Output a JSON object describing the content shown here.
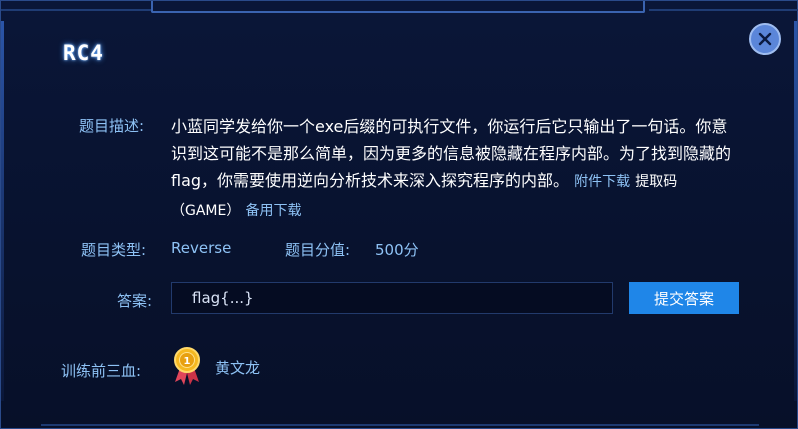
{
  "challenge": {
    "title": "RC4",
    "description_label": "题目描述:",
    "description_text": "小蓝同学发给你一个exe后缀的可执行文件，你运行后它只输出了一句话。你意识到这可能不是那么简单，因为更多的信息被隐藏在程序内部。为了找到隐藏的flag，你需要使用逆向分析技术来深入探究程序的内部。",
    "attachment_link": "附件下载",
    "extract_code": "提取码（GAME）",
    "backup_link": "备用下载",
    "type_label": "题目类型:",
    "type_value": "Reverse",
    "score_label": "题目分值:",
    "score_value": "500分"
  },
  "answer": {
    "label": "答案:",
    "placeholder": "flag{...}",
    "submit_label": "提交答案"
  },
  "first_blood": {
    "label": "训练前三血:",
    "names": [
      "黄文龙"
    ]
  },
  "colors": {
    "accent": "#1f86e8",
    "label_blue": "#8ec2f5",
    "background": "#071029"
  }
}
